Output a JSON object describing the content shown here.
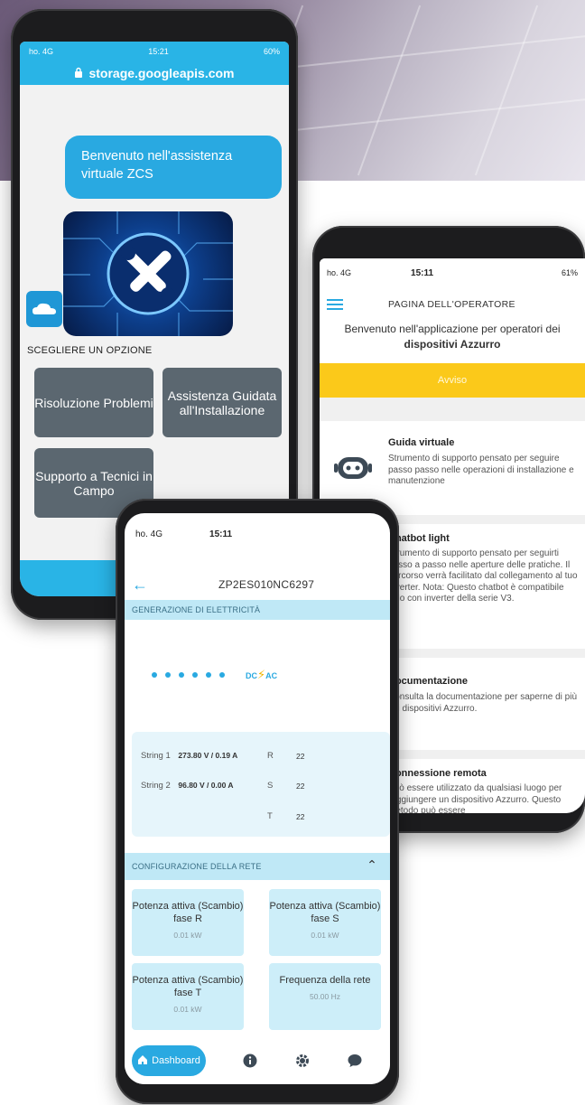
{
  "phone1": {
    "status_left": "ho. 4G",
    "status_time": "15:21",
    "status_right": "60%",
    "url": "storage.googleapis.com",
    "bubble_text": "Benvenuto nell'assistenza virtuale ZCS",
    "choose_label": "SCEGLIERE UN OPZIONE",
    "options": [
      {
        "label": "Risoluzione Problemi"
      },
      {
        "label": "Assistenza Guidata all'Installazione"
      },
      {
        "label": "Supporto a Tecnici in Campo"
      }
    ],
    "accent": "#29b4e6"
  },
  "phone2": {
    "status_left": "ho. 4G",
    "status_time": "15:11",
    "status_right": "61%",
    "page_title": "PAGINA DELL'OPERATORE",
    "welcome_text": "Benvenuto nell'applicazione per operatori dei",
    "welcome_bold": "dispositivi Azzurro",
    "notice_label": "Avviso",
    "notice_color": "#fbc91a",
    "cards": [
      {
        "title": "Guida virtuale",
        "description": "Strumento di supporto pensato per seguire passo passo nelle operazioni di installazione e manutenzione",
        "icon": "robot-icon"
      },
      {
        "title": "Chatbot light",
        "description": "Strumento di supporto pensato per seguirti passo a passo nelle aperture delle pratiche. Il percorso verrà facilitato dal collegamento al tuo inverter. Nota: Questo chatbot è compatibile solo con inverter della serie V3.",
        "icon": "chatbot-icon"
      },
      {
        "title": "Documentazione",
        "description": "Consulta la documentazione per saperne di più sui dispositivi Azzurro.",
        "icon": "document-icon"
      },
      {
        "title": "Connessione remota",
        "description": "Può essere utilizzato da qualsiasi luogo per raggiungere un dispositivo Azzurro. Questo metodo può essere",
        "icon": "remote-device-icon"
      }
    ]
  },
  "phone3": {
    "status_left": "ho. 4G",
    "status_time": "15:11",
    "serial": "ZP2ES010NC6297",
    "section_generation": "GENERAZIONE DI ELETTRICITÀ",
    "dc_label": "DC",
    "ac_label": "AC",
    "strings": [
      {
        "label": "String 1",
        "value": "273.80 V / 0.19 A"
      },
      {
        "label": "String 2",
        "value": "96.80 V / 0.00 A"
      }
    ],
    "phases": [
      {
        "label": "R",
        "value": "22"
      },
      {
        "label": "S",
        "value": "22"
      },
      {
        "label": "T",
        "value": "22"
      }
    ],
    "section_config": "CONFIGURAZIONE DELLA RETE",
    "tiles": [
      {
        "label": "Potenza attiva (Scambio) fase R",
        "value": "0.01 kW"
      },
      {
        "label": "Potenza attiva (Scambio) fase S",
        "value": "0.01 kW"
      },
      {
        "label": "Potenza attiva (Scambio) fase T",
        "value": "0.01 kW"
      },
      {
        "label": "Frequenza della rete",
        "value": "50.00 Hz"
      }
    ],
    "nav": {
      "dashboard_label": "Dashboard",
      "items": [
        "info-icon",
        "gear-icon",
        "chat-icon"
      ]
    }
  }
}
